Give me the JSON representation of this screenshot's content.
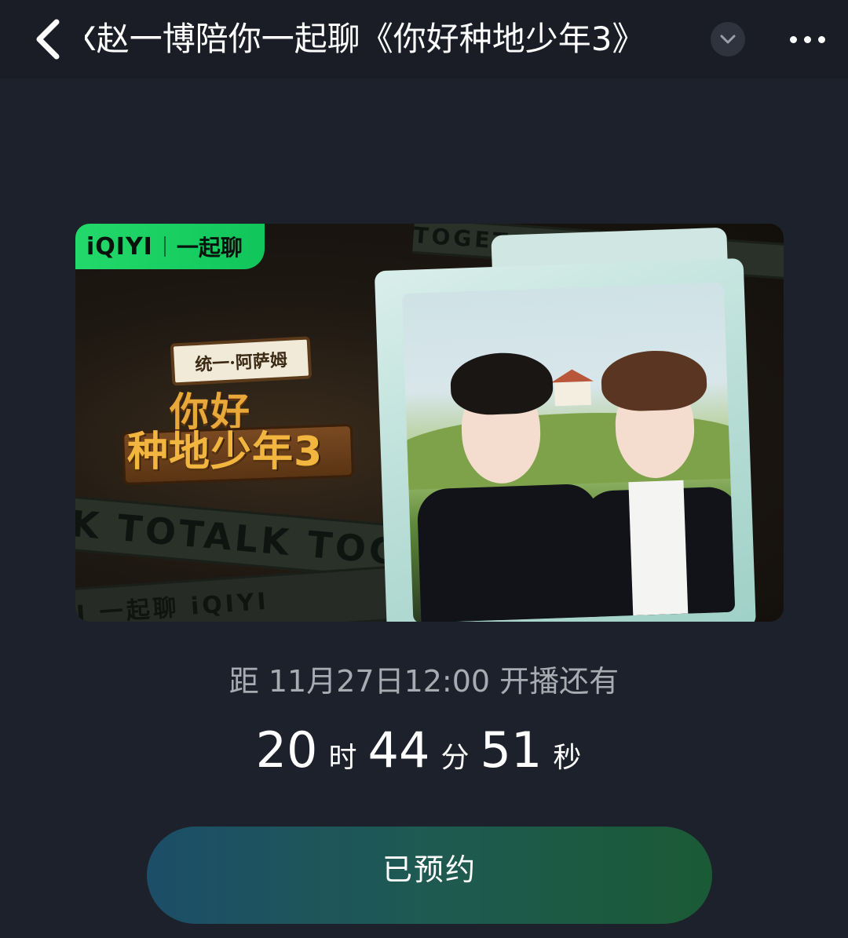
{
  "header": {
    "title": "X赵一博陪你一起聊《你好种地少年3》"
  },
  "banner": {
    "brand_logo": "iQIYI",
    "brand_name": "一起聊",
    "show_sign": "统一·阿萨姆",
    "show_title_line1": "你好",
    "show_title_line2": "种地少年3",
    "tape_text_1": "LK TOTALK TOG",
    "tape_text_2": "IYI 一起聊  iQIYI",
    "tape_text_3": "TOGET"
  },
  "countdown": {
    "label": "距 11月27日12:00 开播还有",
    "hours": "20",
    "hours_unit": "时",
    "minutes": "44",
    "minutes_unit": "分",
    "seconds": "51",
    "seconds_unit": "秒"
  },
  "reserve": {
    "label": "已预约"
  }
}
